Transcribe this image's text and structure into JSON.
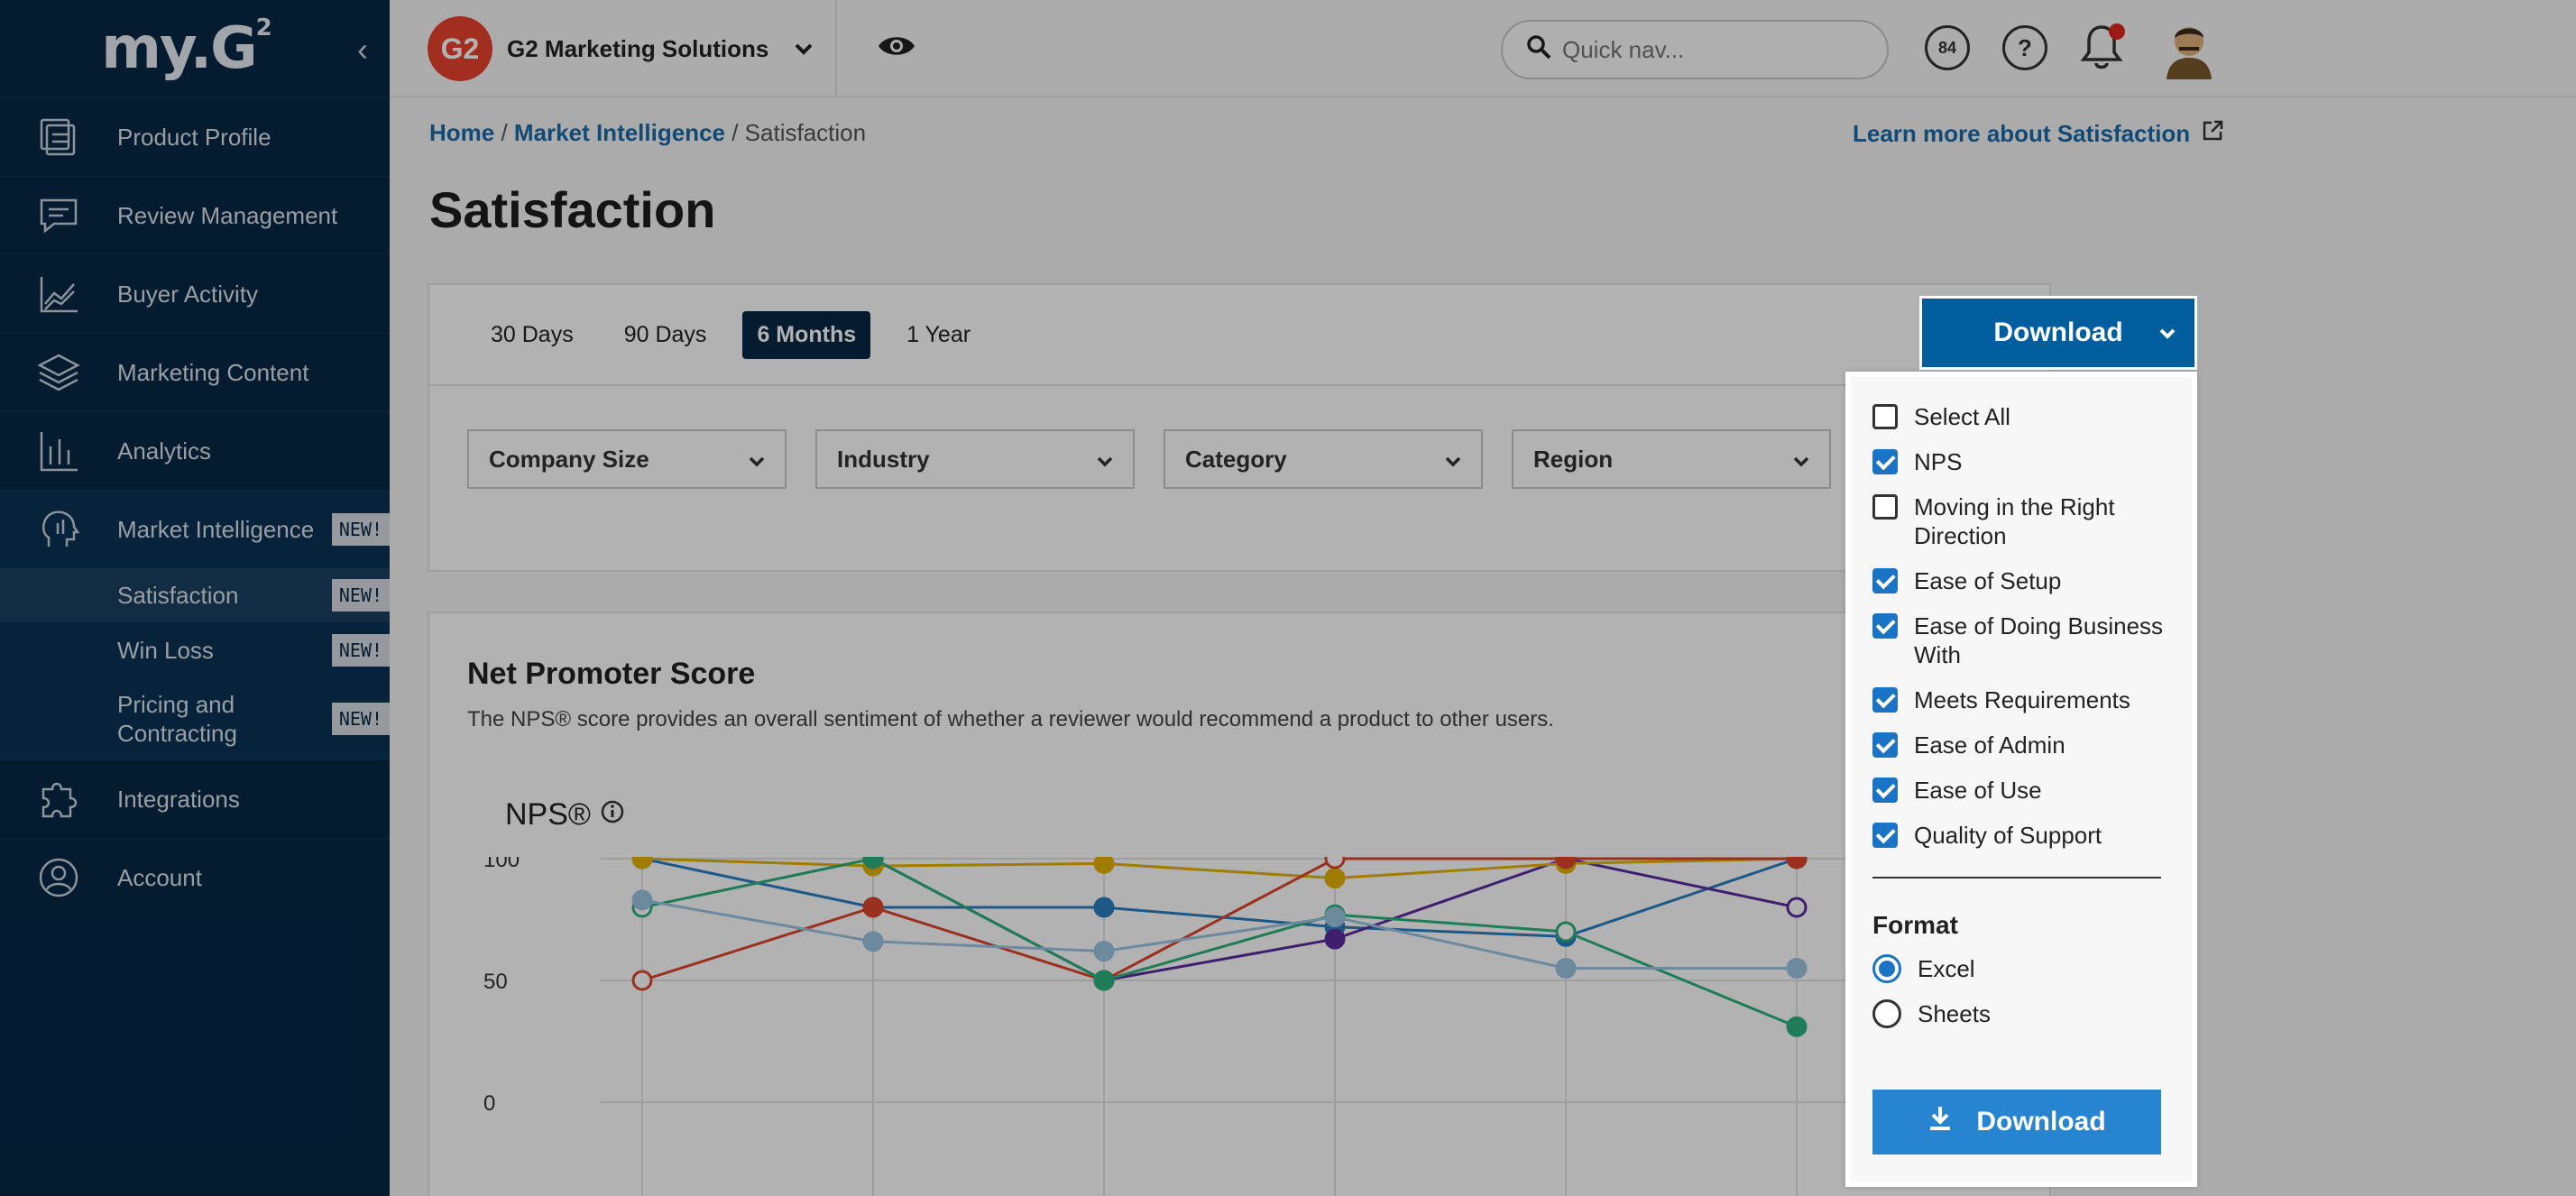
{
  "sidebar": {
    "logo": "my.G",
    "logo_sup": "2",
    "collapse_icon": "‹",
    "items": [
      {
        "label": "Product Profile",
        "icon": "product-profile-icon"
      },
      {
        "label": "Review Management",
        "icon": "review-management-icon"
      },
      {
        "label": "Buyer Activity",
        "icon": "buyer-activity-icon"
      },
      {
        "label": "Marketing Content",
        "icon": "layers-icon"
      },
      {
        "label": "Analytics",
        "icon": "analytics-icon"
      },
      {
        "label": "Market Intelligence",
        "icon": "brain-icon",
        "badge": "NEW!"
      },
      {
        "label": "Integrations",
        "icon": "puzzle-icon"
      },
      {
        "label": "Account",
        "icon": "account-icon"
      }
    ],
    "sub_items": [
      {
        "label": "Satisfaction",
        "badge": "NEW!"
      },
      {
        "label": "Win Loss",
        "badge": "NEW!"
      },
      {
        "label": "Pricing and Contracting",
        "badge": "NEW!"
      }
    ]
  },
  "topbar": {
    "company_badge": "G2",
    "company_name": "G2 Marketing Solutions",
    "search_placeholder": "Quick nav...",
    "points": "84",
    "help": "?",
    "notification_color": "#e0281f"
  },
  "breadcrumb": {
    "home": "Home",
    "sep1": " / ",
    "section": "Market Intelligence",
    "sep2": " / ",
    "current": "Satisfaction"
  },
  "learn_more": "Learn more about Satisfaction",
  "page_title": "Satisfaction",
  "tabs": [
    "30 Days",
    "90 Days",
    "6 Months",
    "1 Year"
  ],
  "active_tab": "6 Months",
  "filters": [
    "Company Size",
    "Industry",
    "Category",
    "Region"
  ],
  "nps_card": {
    "title": "Net Promoter Score",
    "description": "The NPS® score provides an overall sentiment of whether a reviewer would recommend a product to other users."
  },
  "download": {
    "button_label": "Download",
    "options": [
      {
        "label": "Select All",
        "checked": false
      },
      {
        "label": "NPS",
        "checked": true
      },
      {
        "label": "Moving in the Right Direction",
        "checked": false
      },
      {
        "label": "Ease of Setup",
        "checked": true
      },
      {
        "label": "Ease of Doing Business With",
        "checked": true
      },
      {
        "label": "Meets Requirements",
        "checked": true
      },
      {
        "label": "Ease of Admin",
        "checked": true
      },
      {
        "label": "Ease of Use",
        "checked": true
      },
      {
        "label": "Quality of Support",
        "checked": true
      }
    ],
    "format_title": "Format",
    "formats": [
      {
        "label": "Excel",
        "selected": true
      },
      {
        "label": "Sheets",
        "selected": false
      }
    ],
    "submit_label": "Download"
  },
  "chart_data": {
    "type": "line",
    "title": "NPS®",
    "yticks": [
      100,
      50,
      0
    ],
    "ylim": [
      0,
      100
    ],
    "x_count": 6,
    "series": [
      {
        "color": "#2a7fc0",
        "values": [
          100,
          80,
          80,
          72,
          68,
          100
        ],
        "hollow": [
          0,
          5
        ]
      },
      {
        "color": "#5b2aa0",
        "values": [
          null,
          100,
          50,
          67,
          100,
          80
        ],
        "hollow": [
          1,
          2,
          4,
          5
        ]
      },
      {
        "color": "#e6b400",
        "values": [
          100,
          97,
          98,
          92,
          98,
          100
        ]
      },
      {
        "color": "#e0452d",
        "values": [
          50,
          80,
          50,
          100,
          100,
          100
        ],
        "hollow": [
          0,
          3
        ]
      },
      {
        "color": "#2bb37f",
        "values": [
          80,
          100,
          50,
          77,
          70,
          31
        ],
        "hollow": [
          0,
          4
        ]
      },
      {
        "color": "#9dc4e2",
        "values": [
          83,
          66,
          62,
          76,
          55,
          55
        ]
      }
    ]
  }
}
